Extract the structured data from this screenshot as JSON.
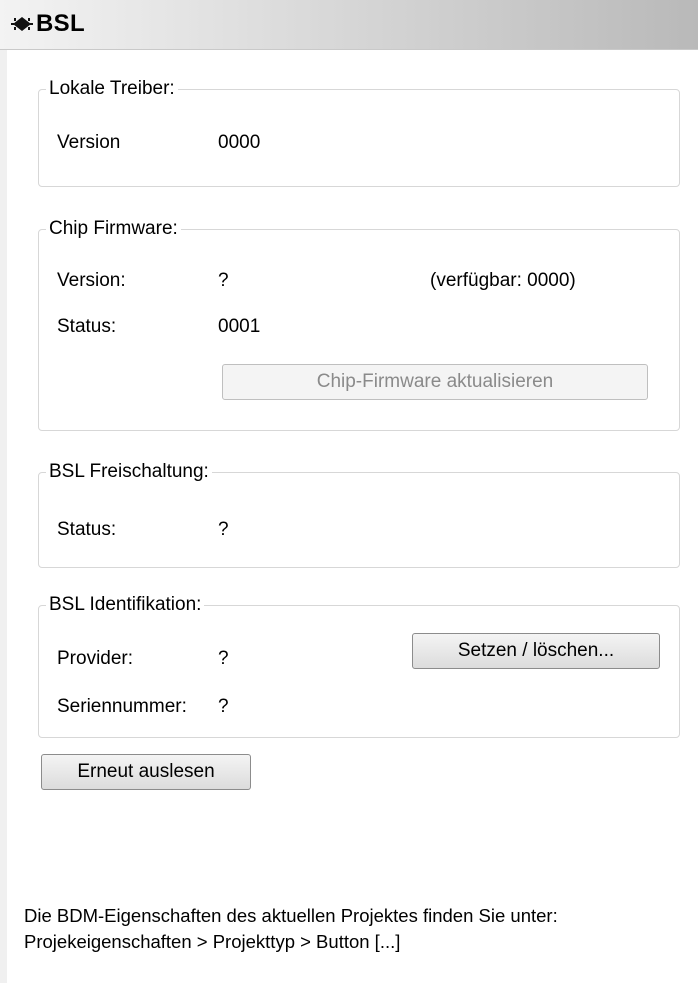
{
  "window": {
    "title": "BSL",
    "title_icon": "chip-icon"
  },
  "local_drivers": {
    "legend": "Lokale Treiber:",
    "version_label": "Version",
    "version_value": "0000"
  },
  "chip_firmware": {
    "legend": "Chip Firmware:",
    "version_label": "Version:",
    "version_value": "?",
    "available_text": "(verfügbar: 0000)",
    "status_label": "Status:",
    "status_value": "0001",
    "update_button": "Chip-Firmware aktualisieren"
  },
  "bsl_unlock": {
    "legend": "BSL Freischaltung:",
    "status_label": "Status:",
    "status_value": "?"
  },
  "bsl_identification": {
    "legend": "BSL Identifikation:",
    "provider_label": "Provider:",
    "provider_value": "?",
    "serial_label": "Seriennummer:",
    "serial_value": "?",
    "set_button": "Setzen / löschen..."
  },
  "reread_button": "Erneut auslesen",
  "info": {
    "line1": "Die BDM-Eigenschaften des aktuellen Projektes finden Sie unter:",
    "line2": "Projekeigenschaften > Projekttyp > Button [...]"
  }
}
